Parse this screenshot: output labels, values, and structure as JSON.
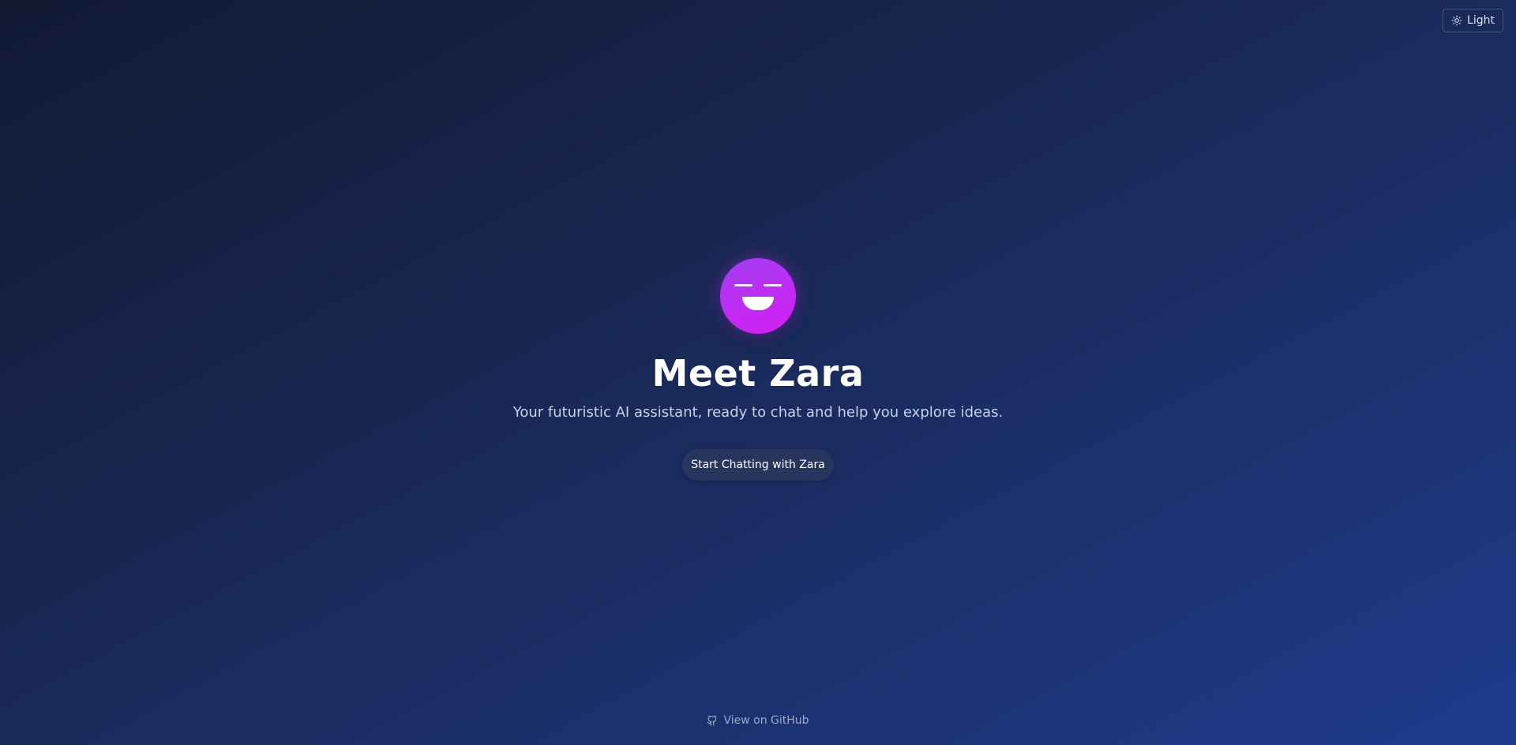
{
  "theme_toggle": {
    "label": "Light",
    "icon": "sun-icon"
  },
  "hero": {
    "avatar_icon": "smiling-face-icon",
    "avatar_color": "#c02cf3",
    "title": "Meet Zara",
    "subtitle": "Your futuristic AI assistant, ready to chat and help you explore ideas.",
    "cta_label": "Start Chatting with Zara"
  },
  "footer": {
    "link_label": "View on GitHub",
    "icon": "github-icon"
  },
  "colors": {
    "background_start": "#121a33",
    "background_end": "#1f3b8c",
    "accent": "#c02cf3",
    "text_primary": "#ffffff",
    "text_secondary": "#c9d1e4"
  }
}
